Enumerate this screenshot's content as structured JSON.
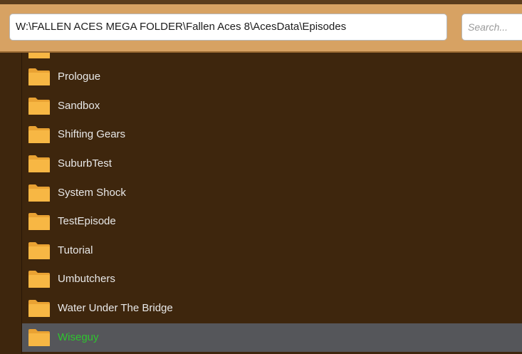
{
  "path_bar": {
    "value": "W:\\FALLEN ACES MEGA FOLDER\\Fallen Aces 8\\AcesData\\Episodes"
  },
  "search": {
    "placeholder": "Search..."
  },
  "colors": {
    "header_bg": "#d7a263",
    "list_bg": "#3e260d",
    "selected_row_bg": "#55565a",
    "selected_text": "#2ec52e",
    "folder_yellow": "#f7b744"
  },
  "folders": [
    {
      "label": "Prologue",
      "selected": false
    },
    {
      "label": "Sandbox",
      "selected": false
    },
    {
      "label": "Shifting Gears",
      "selected": false
    },
    {
      "label": "SuburbTest",
      "selected": false
    },
    {
      "label": "System Shock",
      "selected": false
    },
    {
      "label": "TestEpisode",
      "selected": false
    },
    {
      "label": "Tutorial",
      "selected": false
    },
    {
      "label": "Umbutchers",
      "selected": false
    },
    {
      "label": "Water Under The Bridge",
      "selected": false
    },
    {
      "label": "Wiseguy",
      "selected": true
    }
  ]
}
